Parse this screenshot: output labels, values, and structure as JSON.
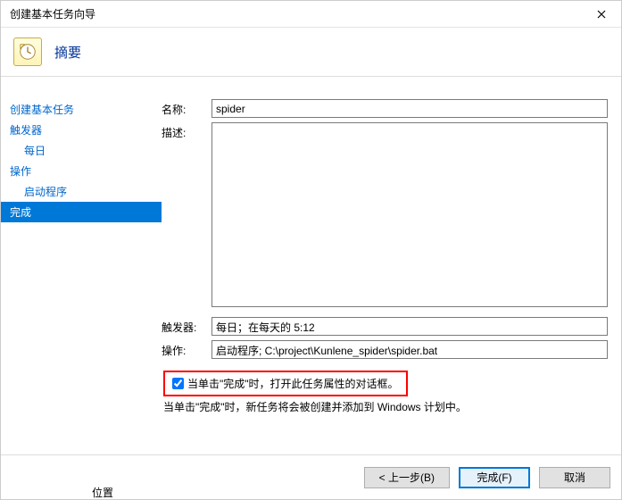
{
  "titlebar": {
    "title": "创建基本任务向导"
  },
  "header": {
    "title": "摘要"
  },
  "nav": {
    "items": [
      {
        "label": "创建基本任务",
        "indent": false,
        "selected": false
      },
      {
        "label": "触发器",
        "indent": false,
        "selected": false
      },
      {
        "label": "每日",
        "indent": true,
        "selected": false
      },
      {
        "label": "操作",
        "indent": false,
        "selected": false
      },
      {
        "label": "启动程序",
        "indent": true,
        "selected": false
      },
      {
        "label": "完成",
        "indent": false,
        "selected": true
      }
    ]
  },
  "form": {
    "name_label": "名称:",
    "name_value": "spider",
    "desc_label": "描述:",
    "desc_value": "",
    "trigger_label": "触发器:",
    "trigger_value": "每日；在每天的 5:12",
    "action_label": "操作:",
    "action_value": "启动程序; C:\\project\\Kunlene_spider\\spider.bat"
  },
  "checkbox": {
    "checked": true,
    "label": "当单击\"完成\"时，打开此任务属性的对话框。"
  },
  "note": "当单击\"完成\"时，新任务将会被创建并添加到 Windows 计划中。",
  "buttons": {
    "back": "< 上一步(B)",
    "finish": "完成(F)",
    "cancel": "取消"
  },
  "bottom_strip": "位置"
}
